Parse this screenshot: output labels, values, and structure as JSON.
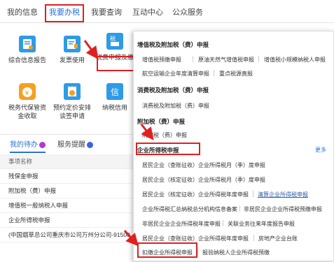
{
  "tabs": [
    "我的信息",
    "我要办税",
    "我要查询",
    "互动中心",
    "公众服务"
  ],
  "icons": [
    {
      "label": "综合信息报告",
      "icon": "report-icon",
      "color": "#2e9be6"
    },
    {
      "label": "发票使用",
      "icon": "invoice-icon",
      "color": "#2e9be6"
    },
    {
      "label": "税费申报及缴",
      "icon": "tax-file-icon",
      "color": "#2e9be6"
    },
    {
      "label": "税务代保管资金收取",
      "icon": "money-bag-icon",
      "color": "#f4a020"
    },
    {
      "label": "预约定价安排谈签申请",
      "icon": "schedule-icon",
      "color": "#2e9be6"
    },
    {
      "label": "纳税信用",
      "icon": "credit-icon",
      "color": "#2e9be6"
    }
  ],
  "lower": {
    "tab_todo": "我的待办",
    "tab_remind": "服务提醒",
    "header": "事项名称",
    "items": [
      "残保金申报",
      "附加税（费）申报",
      "增值税一般纳税人申报",
      "企业所得税申报",
      "(中国烟草总公司重庆市公司万州分公司-91500"
    ]
  },
  "panel": {
    "sec1": "增值税及附加税（费）申报",
    "sec1_links": [
      "增值税预缴申报",
      "原油天然气增值税申报",
      "增值税小规模纳税人申报",
      "航空运输企业年度清算申报",
      "重点税源直报"
    ],
    "sec2": "消费税及附加税（费）申报",
    "sec2_links": [
      "消费税及附加税（费）申报"
    ],
    "sec3": "附加税（费）申报",
    "sec3_links": [
      "附加税（费）申报"
    ],
    "sec4": "企业所得税申报",
    "more": "更多",
    "sec4_links": [
      "居民企业（查账征收）企业所得税月（季）度申报",
      "居民企业（核定征收）企业所得税月（季）度申报",
      "居民企业（核定征收）企业所得税年度申报",
      "清算企业所得税申报",
      "企业所得税汇总纳税总分机构信息备案",
      "非居民企业企业所得税预缴申报",
      "非居民企业企业所得税年度申报",
      "关联业务往来年度报告申报",
      "居民企业（查账征收）企业所得税年度申报",
      "房地产企业台账",
      "扣缴企业所得税申报",
      "报验纳税人企业所得税预缴"
    ]
  }
}
